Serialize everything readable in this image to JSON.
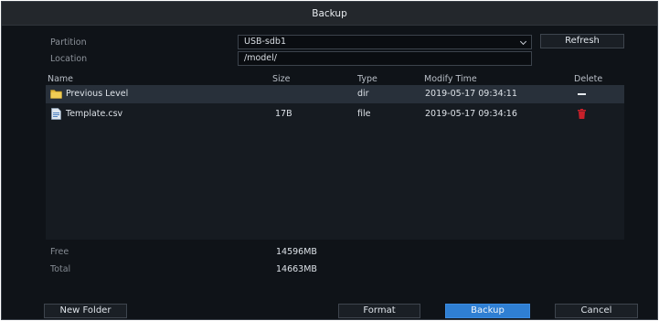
{
  "title": "Backup",
  "partition": {
    "label": "Partition",
    "value": "USB-sdb1"
  },
  "location": {
    "label": "Location",
    "value": "/model/"
  },
  "refresh_label": "Refresh",
  "columns": {
    "name": "Name",
    "size": "Size",
    "type": "Type",
    "modify_time": "Modify Time",
    "delete": "Delete"
  },
  "files": [
    {
      "name": "Previous Level",
      "size": "",
      "type": "dir",
      "modify_time": "2019-05-17 09:34:11",
      "icon": "folder-icon",
      "delete_icon": "dash-icon",
      "selected": true
    },
    {
      "name": "Template.csv",
      "size": "17B",
      "type": "file",
      "modify_time": "2019-05-17 09:34:16",
      "icon": "file-icon",
      "delete_icon": "trash-icon",
      "selected": false
    }
  ],
  "free": {
    "label": "Free",
    "value": "14596MB"
  },
  "total": {
    "label": "Total",
    "value": "14663MB"
  },
  "buttons": {
    "new_folder": "New Folder",
    "format": "Format",
    "backup": "Backup",
    "cancel": "Cancel"
  },
  "colors": {
    "accent": "#2f7fd3",
    "delete": "#c8202a",
    "folder": "#e3b93c"
  }
}
